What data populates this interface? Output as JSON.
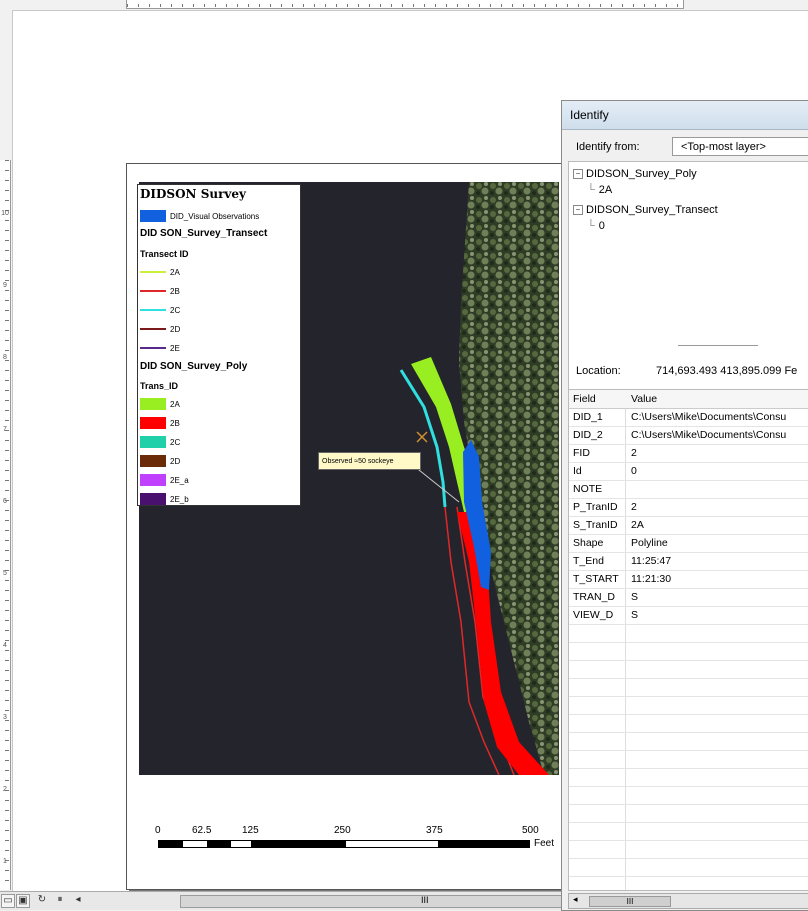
{
  "colors": {
    "water": "#24242c",
    "forest": "#3a4a2e",
    "tr_2A": "#c8f03c",
    "tr_2B": "#e02828",
    "tr_2C": "#30e0e0",
    "tr_2D": "#7a1a1a",
    "tr_2E": "#5a2a8a",
    "poly_2A": "#99ee22",
    "poly_2B": "#ff0000",
    "poly_2C": "#20d0a8",
    "poly_2D": "#6b2a08",
    "poly_2E_a": "#c040ff",
    "poly_2E_b": "#4a1070",
    "visual": "#1060e0"
  },
  "ruler": {
    "left_labels": [
      "10",
      "9",
      "8",
      "7",
      "6",
      "5",
      "4",
      "3",
      "2",
      "1"
    ]
  },
  "legend": {
    "title": "DIDSON Survey",
    "visual_label": "DID_Visual Observations",
    "transect_heading": "DID SON_Survey_Transect",
    "transect_sub": "Transect ID",
    "transects": [
      {
        "label": "2A",
        "color_key": "tr_2A"
      },
      {
        "label": "2B",
        "color_key": "tr_2B"
      },
      {
        "label": "2C",
        "color_key": "tr_2C"
      },
      {
        "label": "2D",
        "color_key": "tr_2D"
      },
      {
        "label": "2E",
        "color_key": "tr_2E"
      }
    ],
    "poly_heading": "DID SON_Survey_Poly",
    "poly_sub": "Trans_ID",
    "polys": [
      {
        "label": "2A",
        "color_key": "poly_2A"
      },
      {
        "label": "2B",
        "color_key": "poly_2B"
      },
      {
        "label": "2C",
        "color_key": "poly_2C"
      },
      {
        "label": "2D",
        "color_key": "poly_2D"
      },
      {
        "label": "2E_a",
        "color_key": "poly_2E_a"
      },
      {
        "label": "2E_b",
        "color_key": "poly_2E_b"
      }
    ]
  },
  "map": {
    "callout": "Observed ≈50 sockeye"
  },
  "scale": {
    "ticks": [
      "0",
      "62.5",
      "125",
      "250",
      "375",
      "500"
    ],
    "unit": "Feet"
  },
  "identify": {
    "title": "Identify",
    "from_label": "Identify from:",
    "from_value": "<Top-most layer>",
    "tree": [
      {
        "layer": "DIDSON_Survey_Poly",
        "child": "2A"
      },
      {
        "layer": "DIDSON_Survey_Transect",
        "child": "0"
      }
    ],
    "location_label": "Location:",
    "location_value": "714,693.493 413,895.099 Fe",
    "columns": [
      "Field",
      "Value"
    ],
    "rows": [
      [
        "DID_1",
        "C:\\Users\\Mike\\Documents\\Consu"
      ],
      [
        "DID_2",
        "C:\\Users\\Mike\\Documents\\Consu"
      ],
      [
        "FID",
        "2"
      ],
      [
        "Id",
        "0"
      ],
      [
        "NOTE",
        ""
      ],
      [
        "P_TranID",
        "2"
      ],
      [
        "S_TranID",
        "2A"
      ],
      [
        "Shape",
        "Polyline"
      ],
      [
        "T_End",
        "11:25:47"
      ],
      [
        "T_START",
        "11:21:30"
      ],
      [
        "TRAN_D",
        "S"
      ],
      [
        "VIEW_D",
        "S"
      ]
    ],
    "hscroll_thumb": "III"
  },
  "statusbar": {
    "scroll_thumb": "III"
  }
}
